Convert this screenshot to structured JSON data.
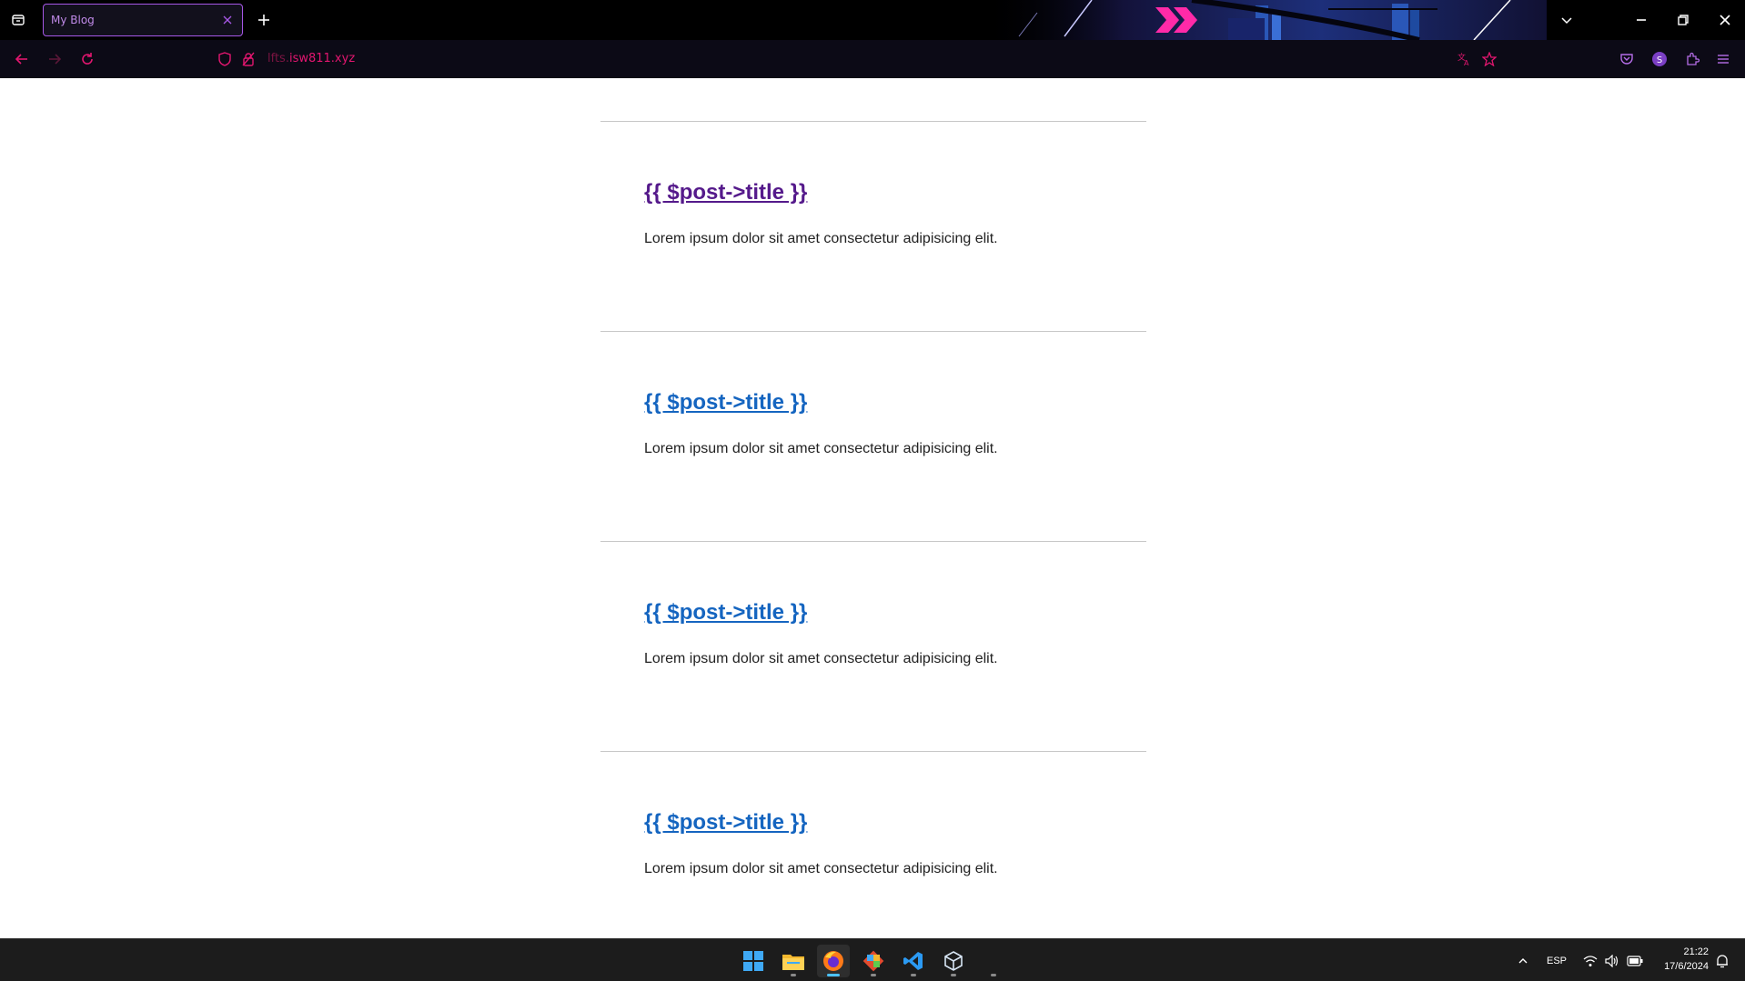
{
  "browser": {
    "tab": {
      "title": "My Blog"
    },
    "url": {
      "prefix": "lfts.",
      "domain": "isw811.xyz"
    },
    "accent_color": "#e2166f",
    "tab_border_color": "#a657e6"
  },
  "posts": [
    {
      "title": "{{ $post->title }}",
      "excerpt": "Lorem ipsum dolor sit amet consectetur adipisicing elit.",
      "visited": true
    },
    {
      "title": "{{ $post->title }}",
      "excerpt": "Lorem ipsum dolor sit amet consectetur adipisicing elit.",
      "visited": false
    },
    {
      "title": "{{ $post->title }}",
      "excerpt": "Lorem ipsum dolor sit amet consectetur adipisicing elit.",
      "visited": false
    },
    {
      "title": "{{ $post->title }}",
      "excerpt": "Lorem ipsum dolor sit amet consectetur adipisicing elit.",
      "visited": false
    }
  ],
  "link_colors": {
    "visited": "#551a8b",
    "unvisited": "#1565c0"
  },
  "taskbar": {
    "apps": [
      {
        "name": "start-menu",
        "icon": "windows-logo-icon"
      },
      {
        "name": "file-explorer",
        "icon": "folder-icon"
      },
      {
        "name": "firefox",
        "icon": "firefox-icon",
        "active": true
      },
      {
        "name": "git",
        "icon": "git-icon"
      },
      {
        "name": "vscode",
        "icon": "vscode-icon"
      },
      {
        "name": "virtualbox",
        "icon": "box-icon"
      }
    ],
    "tray": {
      "language": "ESP",
      "time": "21:22",
      "date": "17/6/2024"
    }
  }
}
